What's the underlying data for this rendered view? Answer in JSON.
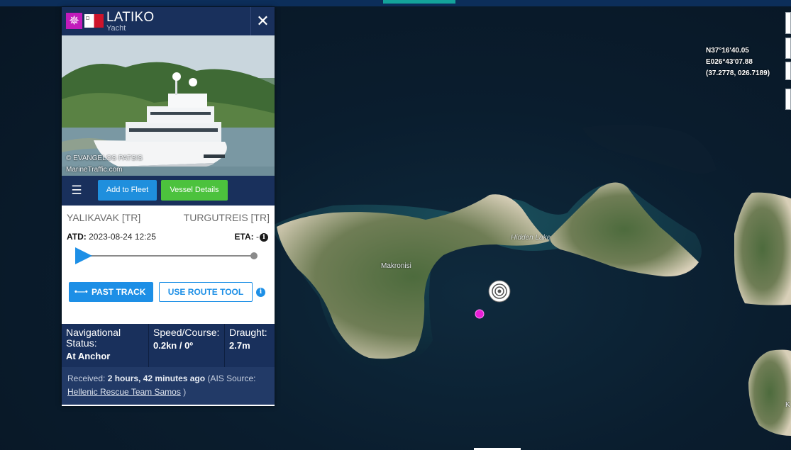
{
  "map": {
    "coordinates": {
      "lat": "N37°16'40.05",
      "lon": "E026°43'07.88",
      "decimal": "(37.2778, 026.7189)"
    },
    "labels": {
      "makronisi": "Makronisi",
      "hidden_lake": "Hidden Lake",
      "edge_letter": "K"
    }
  },
  "panel": {
    "vessel_name": "LATIKO",
    "vessel_type": "Yacht",
    "type_icon": "yacht-icon",
    "flag": "malta-flag",
    "close_label": "✕",
    "photo": {
      "credit_line1": "© EVANGELOS PATSIS",
      "credit_line2": "MarineTraffic.com"
    },
    "toolbar": {
      "menu_label": "☰",
      "add_to_fleet": "Add to Fleet",
      "vessel_details": "Vessel Details"
    },
    "route": {
      "from": "YALIKAVAK [TR]",
      "to": "TURGUTREIS [TR]",
      "atd_label": "ATD:",
      "atd_value": "2023-08-24 12:25",
      "eta_label": "ETA:",
      "eta_value": "-",
      "past_track": "PAST TRACK",
      "route_tool": "USE ROUTE TOOL"
    },
    "status": {
      "nav_label": "Navigational Status:",
      "nav_value": "At Anchor",
      "speed_label": "Speed/Course:",
      "speed_value": "0.2kn / 0º",
      "draught_label": "Draught:",
      "draught_value": "2.7m"
    },
    "received": {
      "prefix": "Received:",
      "ago": "2 hours, 42 minutes ago",
      "source_prefix": "(AIS Source:",
      "source": "Hellenic Rescue Team Samos",
      "suffix": ")"
    }
  },
  "colors": {
    "panel_navy": "#19305c",
    "accent_blue": "#1d8fe6",
    "accent_green": "#4cc23d",
    "yacht_magenta": "#c21bbb"
  }
}
